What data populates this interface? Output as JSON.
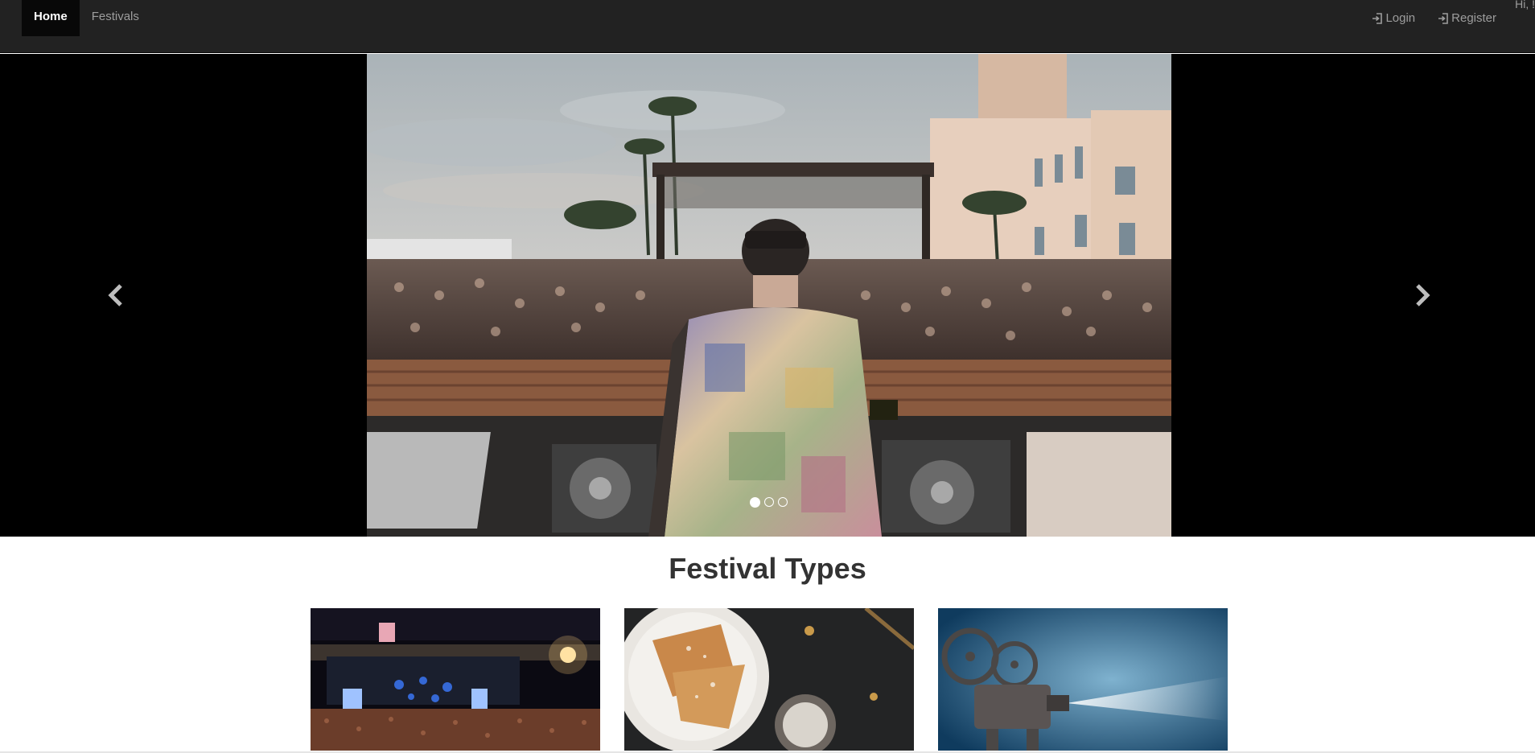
{
  "navbar": {
    "left_items": [
      {
        "label": "Home",
        "active": true
      },
      {
        "label": "Festivals",
        "active": false
      }
    ],
    "right_items": [
      {
        "label": "Login",
        "icon": "log-in-icon"
      },
      {
        "label": "Register",
        "icon": "log-in-icon"
      }
    ],
    "greeting": "Hi, !"
  },
  "carousel": {
    "slide_count": 3,
    "active_index": 0,
    "prev_icon": "chevron-left-icon",
    "next_icon": "chevron-right-icon"
  },
  "festival_types": {
    "title": "Festival Types",
    "cards": [
      {
        "image": "concert-stage-image"
      },
      {
        "image": "food-pastry-image"
      },
      {
        "image": "film-projector-image"
      }
    ]
  },
  "colors": {
    "navbar_bg": "#222222",
    "active_nav_bg": "#080808",
    "nav_text": "#9d9d9d",
    "carousel_bg": "#000000"
  }
}
